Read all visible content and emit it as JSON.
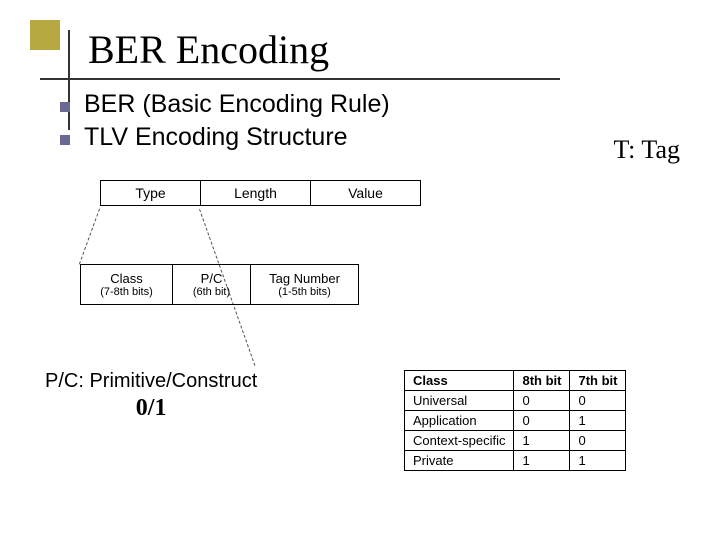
{
  "title": "BER Encoding",
  "bullets": [
    "BER (Basic Encoding Rule)",
    "TLV Encoding Structure"
  ],
  "t_tag": "T: Tag",
  "tlv": {
    "type": "Type",
    "length": "Length",
    "value": "Value"
  },
  "fields": {
    "class_label": "Class",
    "class_sub": "(7-8th bits)",
    "pc_label": "P/C",
    "pc_sub": "(6th bit)",
    "tag_label": "Tag Number",
    "tag_sub": "(1-5th bits)"
  },
  "pc_note": {
    "line": "P/C: Primitive/Construct",
    "zero_one": "0/1"
  },
  "class_table": {
    "headers": [
      "Class",
      "8th bit",
      "7th bit"
    ],
    "rows": [
      [
        "Universal",
        "0",
        "0"
      ],
      [
        "Application",
        "0",
        "1"
      ],
      [
        "Context-specific",
        "1",
        "0"
      ],
      [
        "Private",
        "1",
        "1"
      ]
    ]
  }
}
